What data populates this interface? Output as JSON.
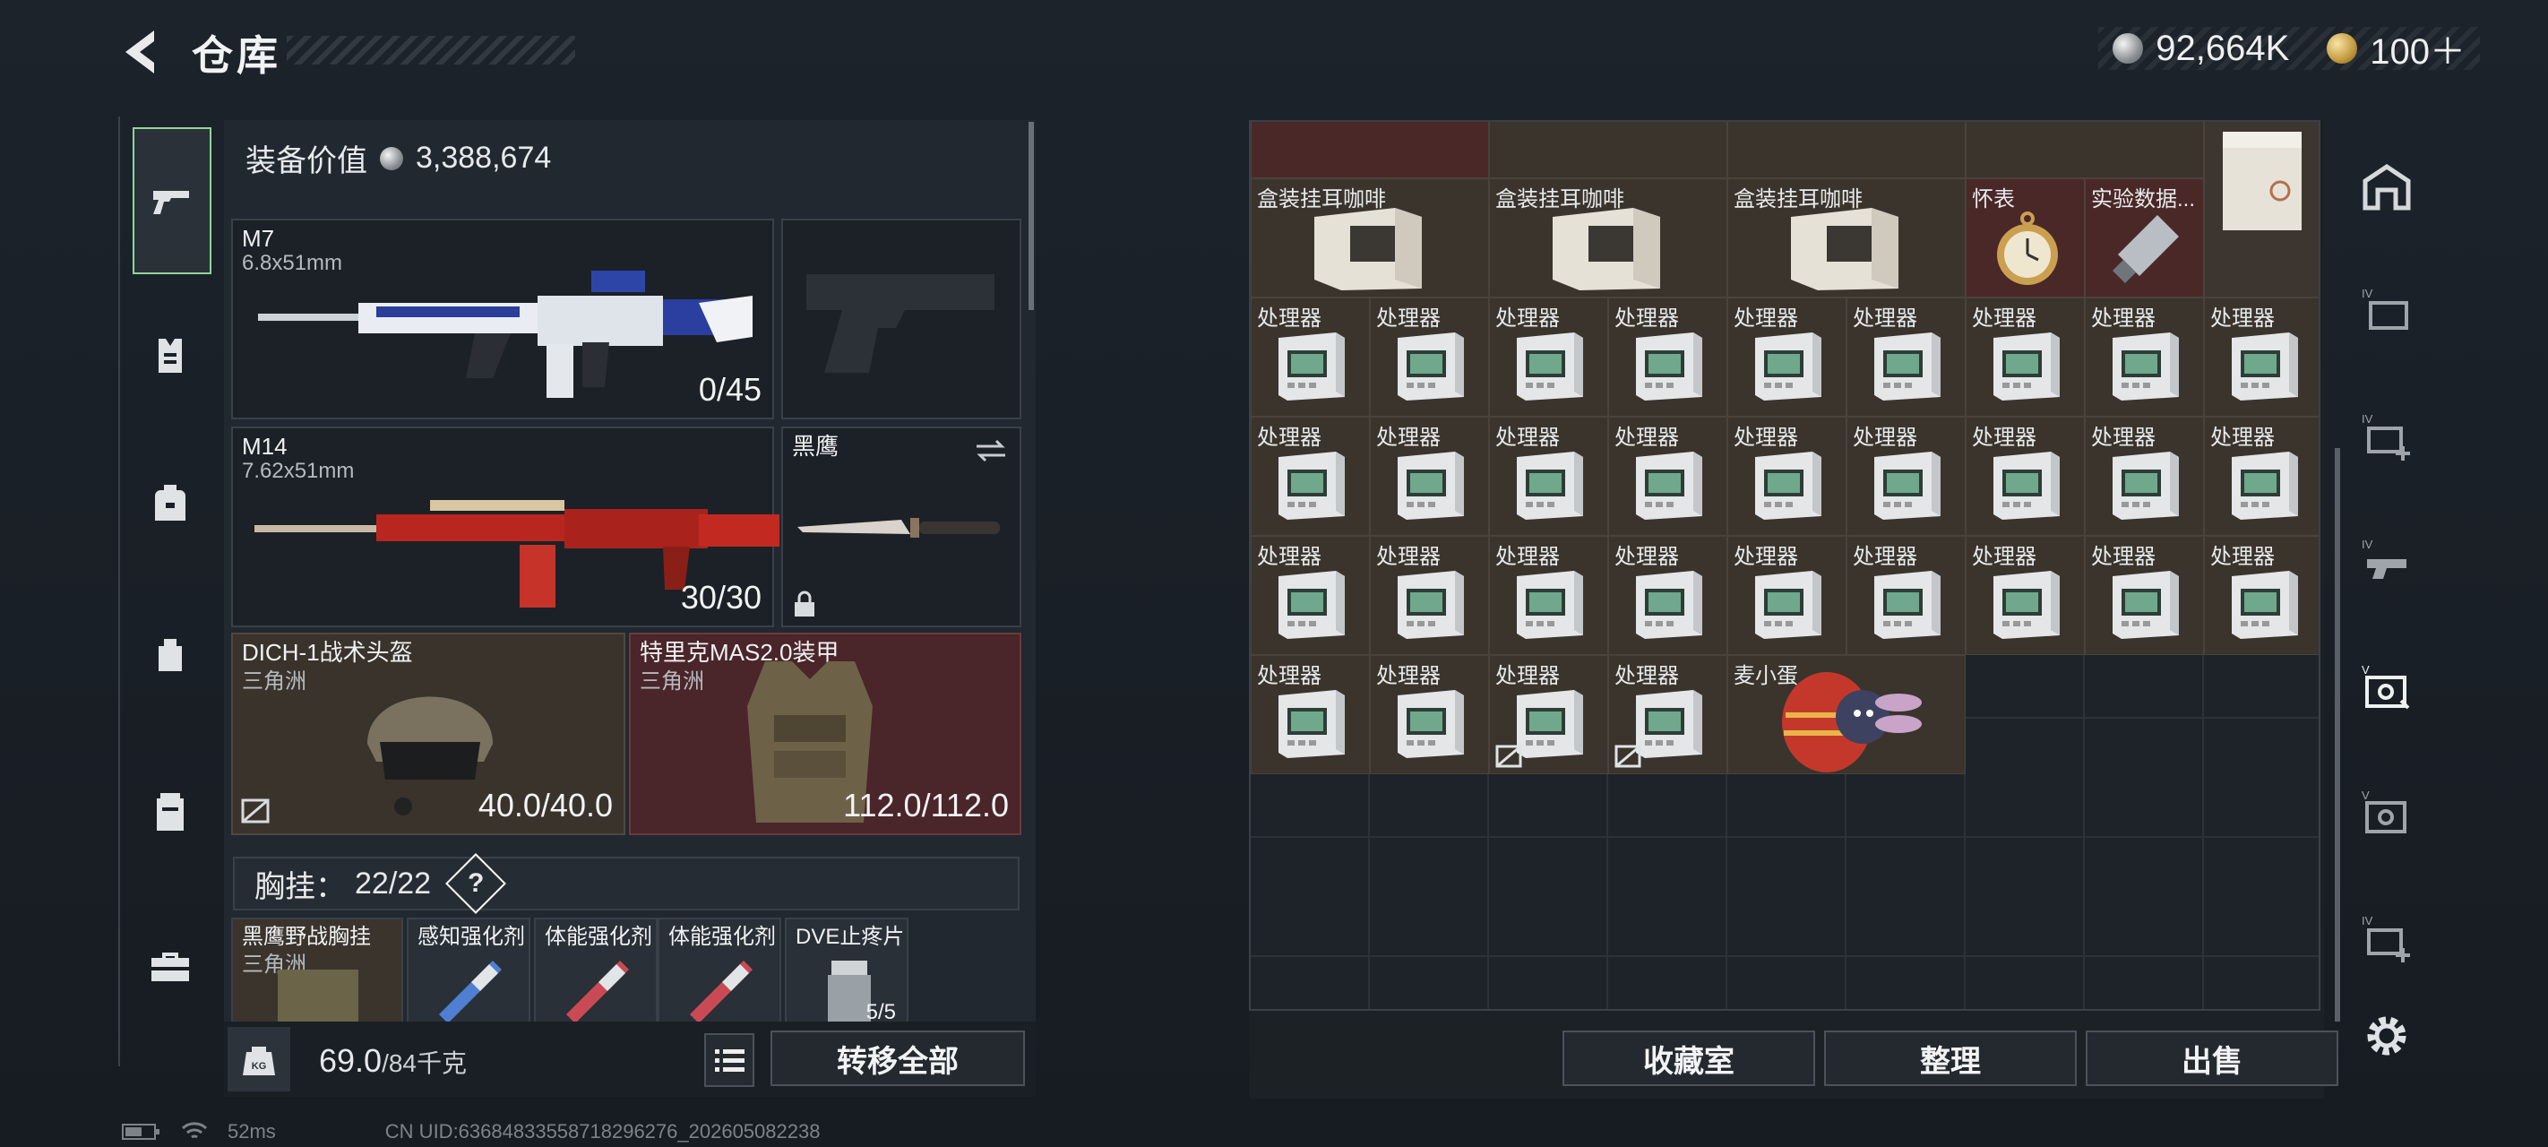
{
  "header": {
    "title": "仓库",
    "currency1": "92,664K",
    "currency2": "100＋"
  },
  "equipment": {
    "value_label": "装备价值",
    "value": "3,388,674",
    "primary": {
      "name": "M7",
      "caliber": "6.8x51mm",
      "ammo": "0/45"
    },
    "secondary": {
      "name": "M14",
      "caliber": "7.62x51mm",
      "ammo": "30/30"
    },
    "melee": {
      "name": "黑鹰"
    },
    "helmet": {
      "name": "DICH-1战术头盔",
      "origin": "三角洲",
      "durability": "40.0/40.0"
    },
    "armor": {
      "name": "特里克MAS2.0装甲",
      "origin": "三角洲",
      "durability": "112.0/112.0"
    },
    "chest_rig": {
      "label": "胸挂：",
      "capacity": "22/22",
      "help": "?"
    },
    "rig_items": [
      {
        "name": "黑鹰野战胸挂",
        "sub": "三角洲"
      },
      {
        "name": "感知强化剂"
      },
      {
        "name": "体能强化剂"
      },
      {
        "name": "体能强化剂"
      },
      {
        "name": "DVE止疼片",
        "qty": "5/5"
      }
    ],
    "weight": "69.0",
    "weight_max": "/84千克",
    "transfer_all": "转移全部"
  },
  "storage": {
    "items_top": [
      "盒装挂耳咖啡",
      "盒装挂耳咖啡",
      "盒装挂耳咖啡",
      "怀表",
      "实验数据..."
    ],
    "processor_label": "处理器",
    "egg_label": "麦小蛋",
    "buttons": {
      "collection": "收藏室",
      "sort": "整理",
      "sell": "出售"
    }
  },
  "status": {
    "ping": "52ms",
    "uid": "CN UID:6368483355871829627​6_202605082238"
  },
  "colors": {
    "accent_green": "#8fd49b",
    "cell_brown": "#3a342d",
    "cell_red": "#4a2828"
  }
}
